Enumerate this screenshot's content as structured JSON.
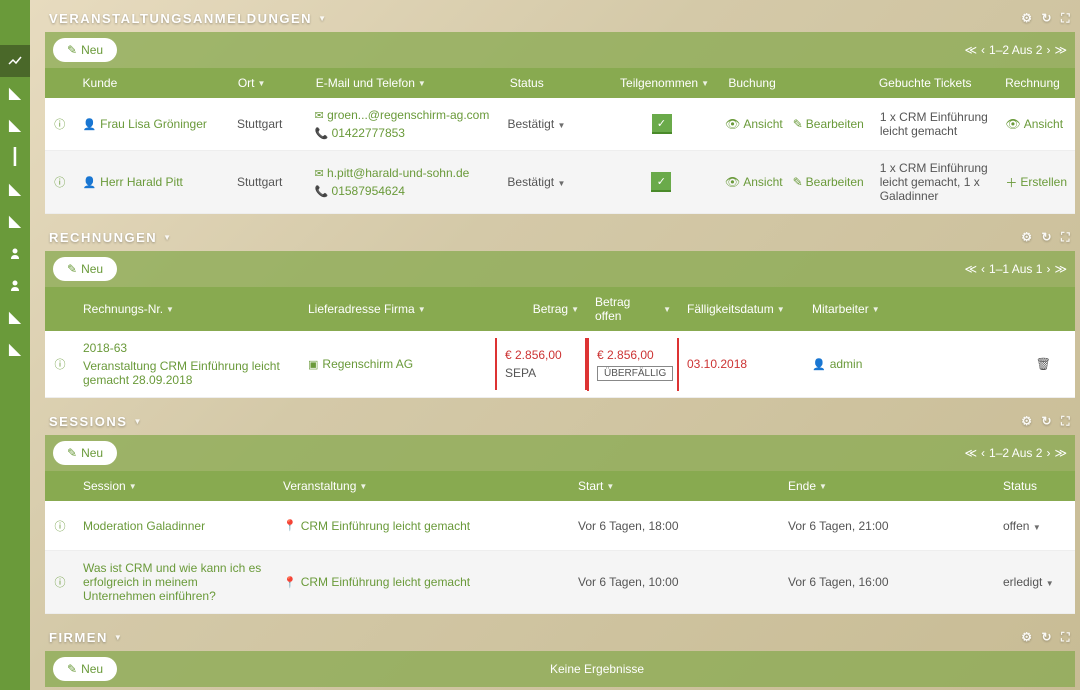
{
  "neu_label": "Neu",
  "sidebar": {
    "items": [
      "trend",
      "slice",
      "slice",
      "fork",
      "slice",
      "slice",
      "person",
      "person",
      "slice",
      "slice"
    ]
  },
  "panels": {
    "registrations": {
      "title": "VERANSTALTUNGSANMELDUNGEN",
      "pager": "1–2 Aus 2",
      "headers": {
        "kunde": "Kunde",
        "ort": "Ort",
        "email": "E-Mail und Telefon",
        "status": "Status",
        "teil": "Teilgenommen",
        "buchung": "Buchung",
        "tickets": "Gebuchte Tickets",
        "rechnung": "Rechnung"
      },
      "rows": [
        {
          "kunde": "Frau Lisa Gröninger",
          "ort": "Stuttgart",
          "email": "groen...@regenschirm-ag.com",
          "phone": "01422777853",
          "status": "Bestätigt",
          "teil": true,
          "ansicht": "Ansicht",
          "bearbeiten": "Bearbeiten",
          "tickets": "1 x CRM Einführung leicht gemacht",
          "rechnung_label": "Ansicht",
          "rechnung_icon": "eye"
        },
        {
          "kunde": "Herr Harald Pitt",
          "ort": "Stuttgart",
          "email": "h.pitt@harald-und-sohn.de",
          "phone": "01587954624",
          "status": "Bestätigt",
          "teil": true,
          "ansicht": "Ansicht",
          "bearbeiten": "Bearbeiten",
          "tickets": "1 x CRM Einführung leicht gemacht, 1 x Galadinner",
          "rechnung_label": "Erstellen",
          "rechnung_icon": "plus"
        }
      ]
    },
    "invoices": {
      "title": "RECHNUNGEN",
      "pager": "1–1 Aus 1",
      "headers": {
        "nr": "Rechnungs-Nr.",
        "firma": "Lieferadresse Firma",
        "betrag": "Betrag",
        "offen": "Betrag offen",
        "datum": "Fälligkeitsdatum",
        "mit": "Mitarbeiter"
      },
      "rows": [
        {
          "nr": "2018-63",
          "desc": "Veranstaltung CRM Einführung leicht gemacht 28.09.2018",
          "firma": "Regenschirm AG",
          "betrag": "€ 2.856,00",
          "betrag_sub": "SEPA",
          "offen": "€ 2.856,00",
          "offen_badge": "ÜBERFÄLLIG",
          "datum": "03.10.2018",
          "mit": "admin"
        }
      ]
    },
    "sessions": {
      "title": "SESSIONS",
      "pager": "1–2 Aus 2",
      "headers": {
        "session": "Session",
        "ver": "Veranstaltung",
        "start": "Start",
        "ende": "Ende",
        "status": "Status"
      },
      "rows": [
        {
          "session": "Moderation Galadinner",
          "ver": "CRM Einführung leicht gemacht",
          "start": "Vor 6 Tagen, 18:00",
          "ende": "Vor 6 Tagen, 21:00",
          "status": "offen"
        },
        {
          "session": "Was ist CRM und wie kann ich es erfolgreich in meinem Unternehmen einführen?",
          "ver": "CRM Einführung leicht gemacht",
          "start": "Vor 6 Tagen, 10:00",
          "ende": "Vor 6 Tagen, 16:00",
          "status": "erledigt"
        }
      ]
    },
    "companies": {
      "title": "FIRMEN",
      "no_results": "Keine Ergebnisse"
    }
  }
}
